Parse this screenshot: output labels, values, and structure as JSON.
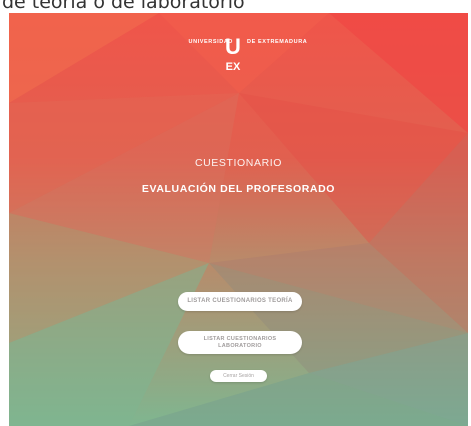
{
  "caption": "de teoría o de laboratorio",
  "logo": {
    "left_text": "UNIVERSIDAD",
    "right_text": "DE EXTREMADURA",
    "mark_top": "U",
    "mark_bottom": "EX"
  },
  "header": {
    "subtitle": "CUESTIONARIO",
    "title": "EVALUACIÓN DEL PROFESORADO"
  },
  "actions": {
    "teoria_label": "LISTAR CUESTIONARIOS TEORÍA",
    "laboratorio_label": "LISTAR CUESTIONARIOS LABORATORIO",
    "logout_label": "Cerrar Sesión"
  },
  "colors": {
    "background_top": "#f0524a",
    "background_bottom": "#7fb895",
    "button_bg": "#ffffff",
    "button_text": "#a09c9c"
  }
}
